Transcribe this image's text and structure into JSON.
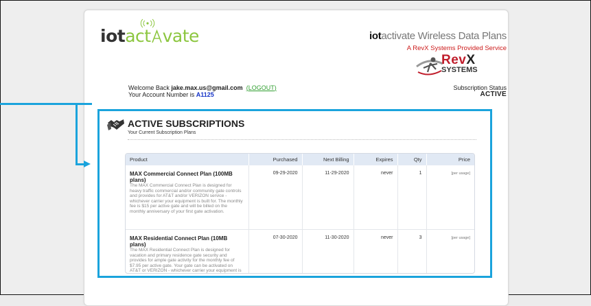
{
  "brand": {
    "logo_part1": "iot",
    "logo_part2": "act",
    "logo_part3": "vate",
    "header_bold": "iot",
    "header_rest": "activate Wireless Data Plans",
    "header_sub": "A RevX Systems Provided Service",
    "revx_word_a": "Rev",
    "revx_word_b": "X",
    "revx_systems": "SYSTEMS",
    "accent": "#8cc63f",
    "highlight": "#1aa3dc"
  },
  "account": {
    "welcome_prefix": "Welcome Back ",
    "email": "jake.max.us@gmail.com",
    "logout_open": "(",
    "logout_label": "LOGOUT",
    "logout_close": ")",
    "account_prefix": "Your Account Number is ",
    "account_number": "A1125",
    "status_label": "Subscription Status",
    "status_value": "ACTIVE"
  },
  "section": {
    "title": "ACTIVE SUBSCRIPTIONS",
    "subtitle": "Your Current Subscription Plans",
    "icon": "handshake-icon"
  },
  "table": {
    "headers": [
      "Product",
      "Purchased",
      "Next Billing",
      "Expires",
      "Qty",
      "Price"
    ],
    "rows": [
      {
        "name": "MAX Commercial Connect Plan (100MB plans)",
        "description": "The MAX Commercial Connect Plan is designed for heavy traffic commercial and/or community gate controls and provides for AT&T and/or VERIZON service - whichever carrier your equipment is built for. The monthly fee is $15 per active gate and will be billed on the monthly anniversary of your first gate activation.",
        "purchased": "09-29-2020",
        "next_billing": "11-29-2020",
        "expires": "never",
        "qty": "1",
        "price": "[per usage]"
      },
      {
        "name": "MAX Residential Connect Plan (10MB plans)",
        "description": "The MAX Residential Connect Plan is designed for vacation and primary residence gate security and provides for ample gate activity for the monthly fee of $7.95 per active gate. Your gate can be activated on AT&T or VERIZON - whichever carrier your equipment is built for.",
        "purchased": "07-30-2020",
        "next_billing": "11-30-2020",
        "expires": "never",
        "qty": "3",
        "price": "[per usage]"
      }
    ]
  }
}
